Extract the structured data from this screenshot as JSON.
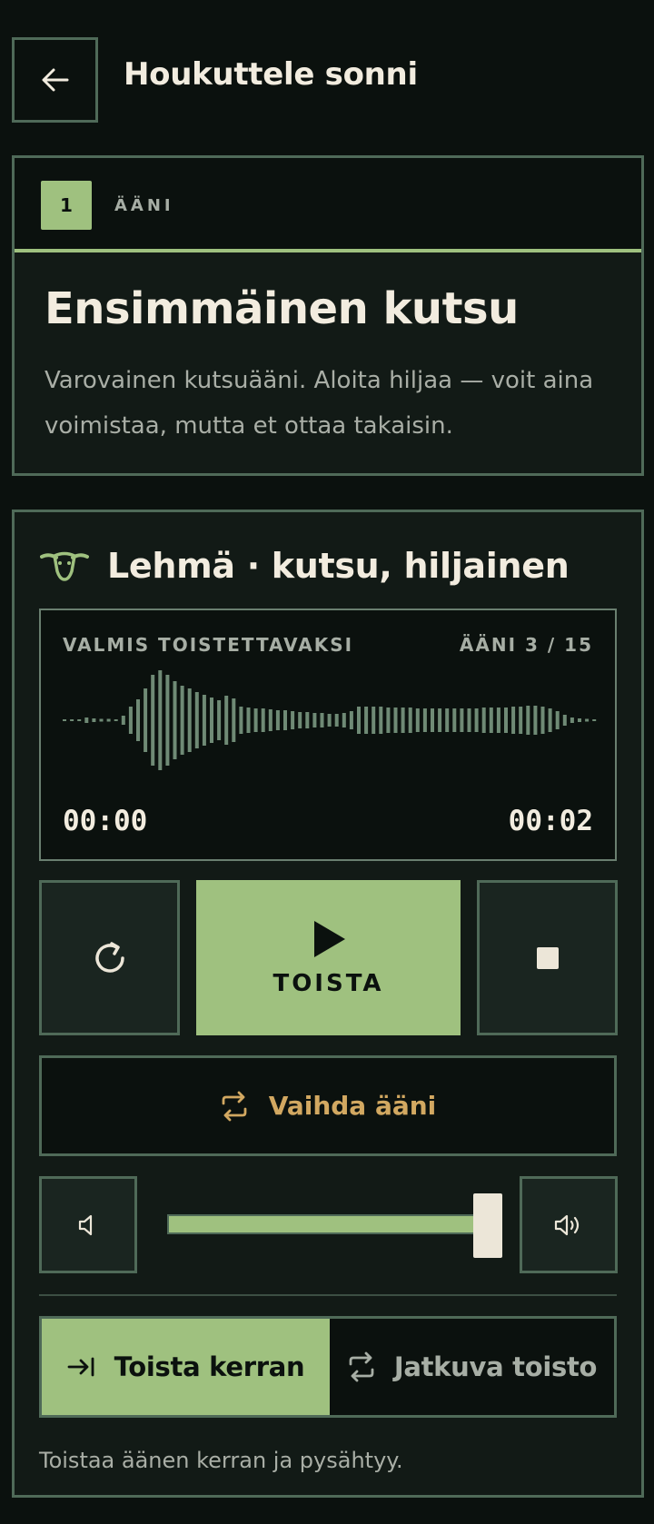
{
  "header": {
    "title": "Houkuttele sonni",
    "back_icon": "arrow-left-icon"
  },
  "step": {
    "number": "1",
    "kind": "ÄÄNI",
    "title": "Ensimmäinen kutsu",
    "description": "Varovainen kutsuääni. Aloita hiljaa — voit aina voimistaa, mutta et ottaa takaisin."
  },
  "sound": {
    "icon": "cow-head-icon",
    "title": "Lehmä · kutsu, hiljainen",
    "status": "VALMIS TOISTETTAVAKSI",
    "count": "ÄÄNI 3 / 15",
    "time_current": "00:00",
    "time_total": "00:02"
  },
  "controls": {
    "play_label": "TOISTA",
    "switch_label": "Vaihda ääni",
    "volume_level": 0.94
  },
  "mode": {
    "once_label": "Toista kerran",
    "loop_label": "Jatkuva toisto",
    "selected": "once",
    "help": "Toistaa äänen kerran ja pysähtyy."
  },
  "colors": {
    "background": "#0b110e",
    "accent": "#9fc17f",
    "border": "#4f6a58",
    "warm": "#d2a861",
    "text": "#f2ecdf"
  }
}
